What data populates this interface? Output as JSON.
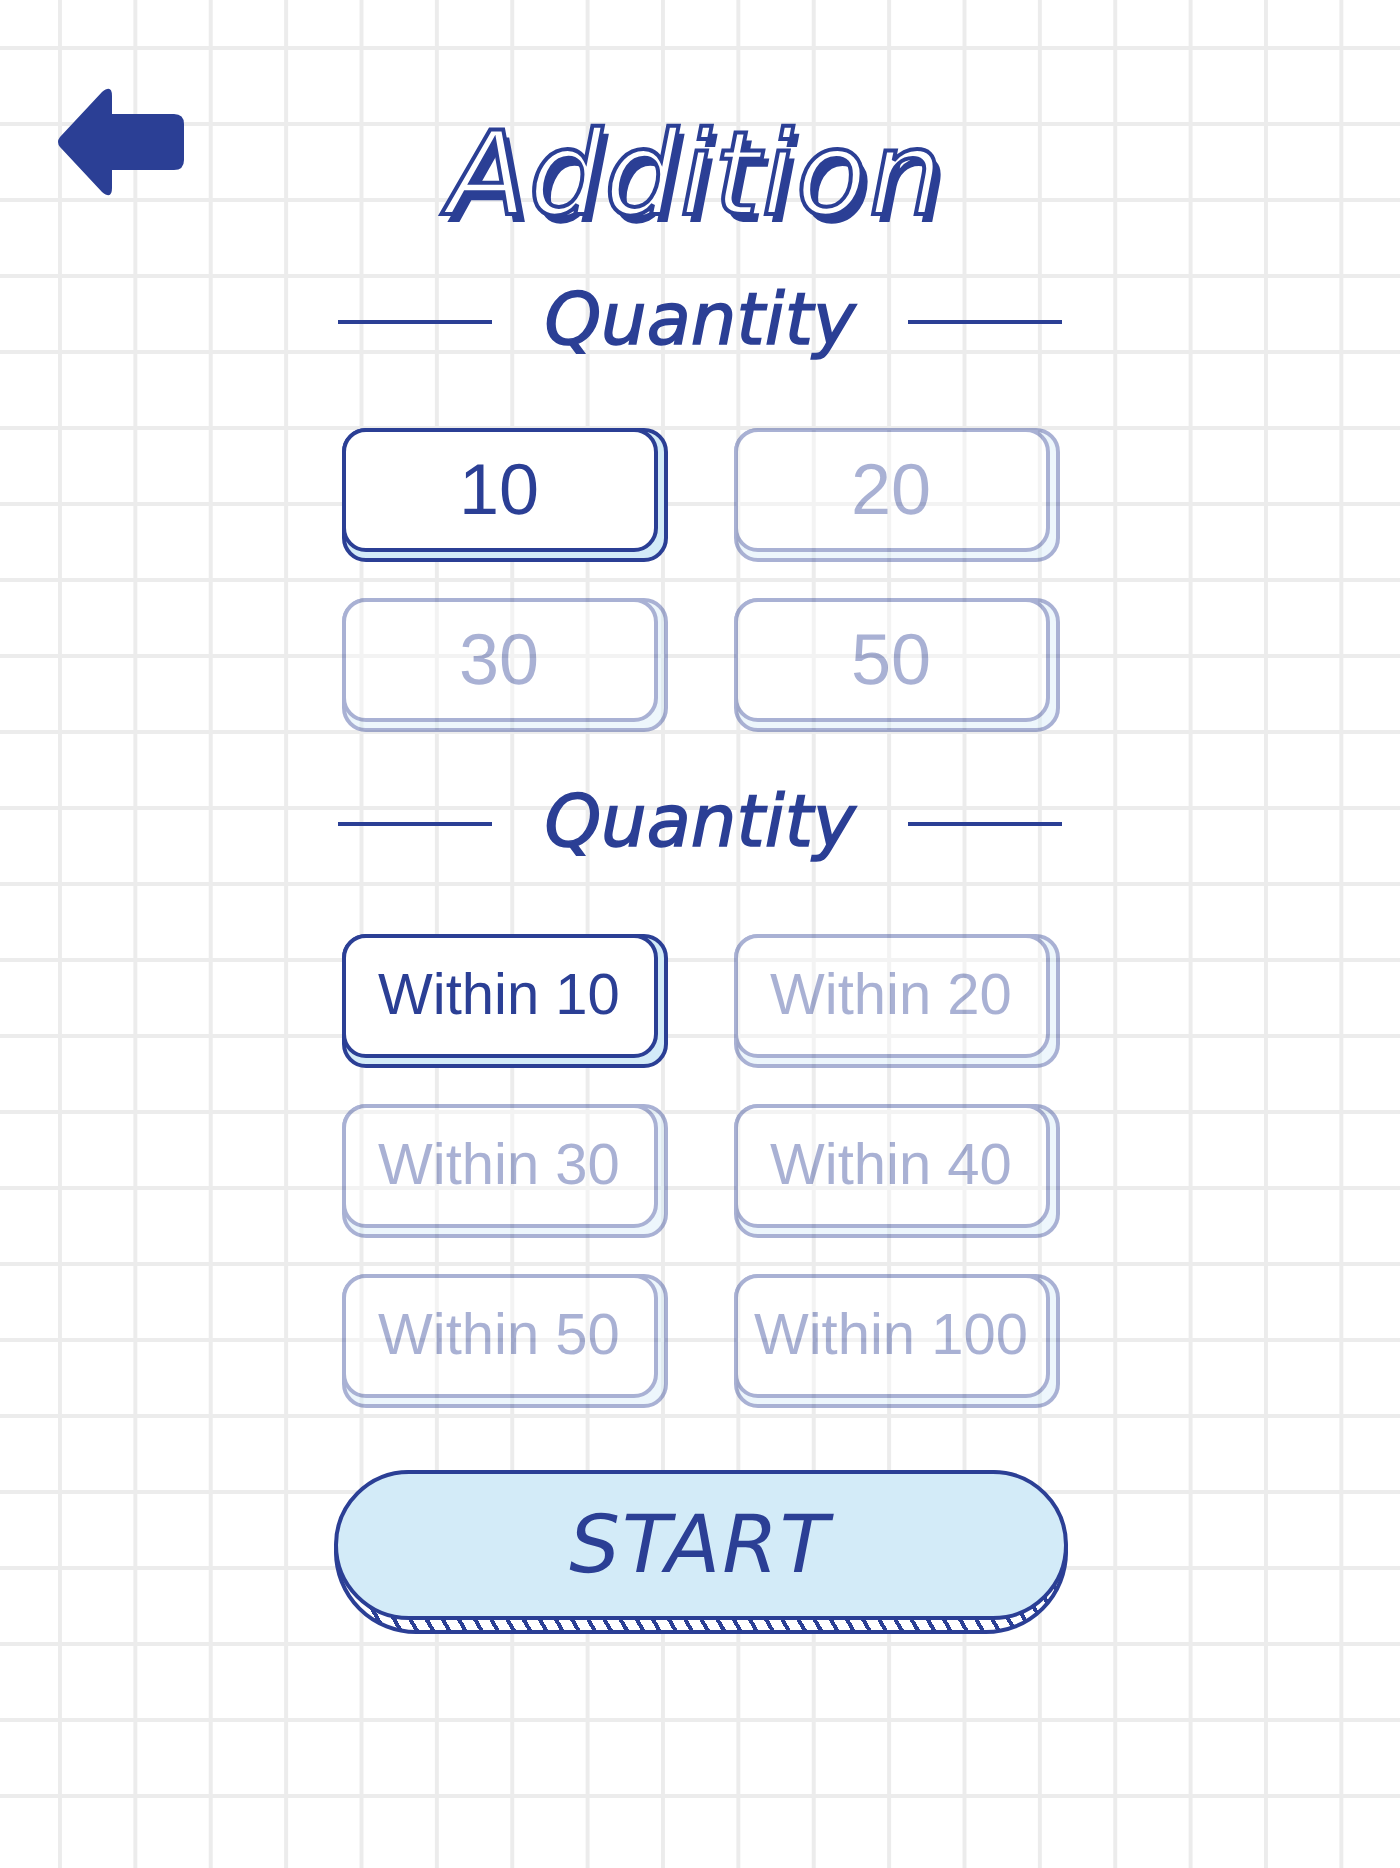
{
  "title": "Addition",
  "sections": [
    {
      "heading": "Quantity",
      "options": [
        {
          "label": "10",
          "selected": true
        },
        {
          "label": "20",
          "selected": false
        },
        {
          "label": "30",
          "selected": false
        },
        {
          "label": "50",
          "selected": false
        }
      ]
    },
    {
      "heading": "Quantity",
      "options": [
        {
          "label": "Within 10",
          "selected": true
        },
        {
          "label": "Within 20",
          "selected": false
        },
        {
          "label": "Within 30",
          "selected": false
        },
        {
          "label": "Within 40",
          "selected": false
        },
        {
          "label": "Within 50",
          "selected": false
        },
        {
          "label": "Within 100",
          "selected": false
        }
      ]
    }
  ],
  "start_button": {
    "label": "START"
  }
}
